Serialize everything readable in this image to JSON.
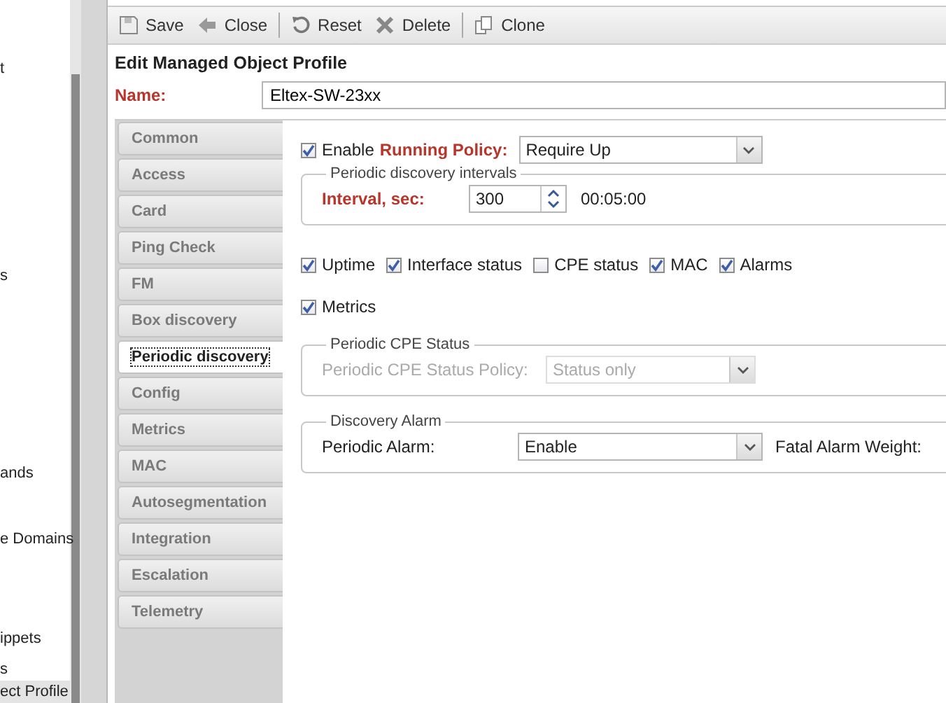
{
  "sidebar": {
    "items": [
      {
        "label": "t",
        "selected": false
      },
      {
        "label": "s",
        "selected": false
      },
      {
        "label": "ands",
        "selected": false
      },
      {
        "label": "e Domains",
        "selected": false
      },
      {
        "label": "ippets",
        "selected": false
      },
      {
        "label": "s",
        "selected": false
      },
      {
        "label": "ect Profile",
        "selected": true
      }
    ]
  },
  "toolbar": {
    "buttons": [
      {
        "label": "Save",
        "kind": "save",
        "separator_before": false
      },
      {
        "label": "Close",
        "kind": "close",
        "separator_before": false
      },
      {
        "label": "Reset",
        "kind": "reset",
        "separator_before": true
      },
      {
        "label": "Delete",
        "kind": "delete",
        "separator_before": false
      },
      {
        "label": "Clone",
        "kind": "clone",
        "separator_before": true
      }
    ]
  },
  "form": {
    "title": "Edit Managed Object Profile",
    "name": {
      "label": "Name:",
      "value": "Eltex-SW-23xx"
    }
  },
  "tabs": [
    {
      "label": "Common",
      "selected": false
    },
    {
      "label": "Access",
      "selected": false
    },
    {
      "label": "Card",
      "selected": false
    },
    {
      "label": "Ping Check",
      "selected": false
    },
    {
      "label": "FM",
      "selected": false
    },
    {
      "label": "Box discovery",
      "selected": false
    },
    {
      "label": "Periodic discovery",
      "selected": true
    },
    {
      "label": "Config",
      "selected": false
    },
    {
      "label": "Metrics",
      "selected": false
    },
    {
      "label": "MAC",
      "selected": false
    },
    {
      "label": "Autosegmentation",
      "selected": false
    },
    {
      "label": "Integration",
      "selected": false
    },
    {
      "label": "Escalation",
      "selected": false
    },
    {
      "label": "Telemetry",
      "selected": false
    }
  ],
  "panel": {
    "running_policy": {
      "checked": true,
      "prefix": "Enable",
      "label": "Running Policy:",
      "value": "Require Up"
    },
    "intervals": {
      "legend": "Periodic discovery intervals",
      "label": "Interval, sec:",
      "value": "300",
      "readout": "00:05:00"
    },
    "option_rows": [
      [
        {
          "label": "Uptime",
          "checked": true
        },
        {
          "label": "Interface status",
          "checked": true
        },
        {
          "label": "CPE status",
          "checked": false
        },
        {
          "label": "MAC",
          "checked": true
        },
        {
          "label": "Alarms",
          "checked": true
        }
      ],
      [
        {
          "label": "Metrics",
          "checked": true
        }
      ]
    ],
    "cpe_status": {
      "legend": "Periodic CPE Status",
      "label": "Periodic CPE Status Policy:",
      "value": "Status only",
      "disabled": true
    },
    "alarm": {
      "legend": "Discovery Alarm",
      "label": "Periodic Alarm:",
      "value": "Enable",
      "weight_label": "Fatal Alarm Weight:"
    }
  }
}
